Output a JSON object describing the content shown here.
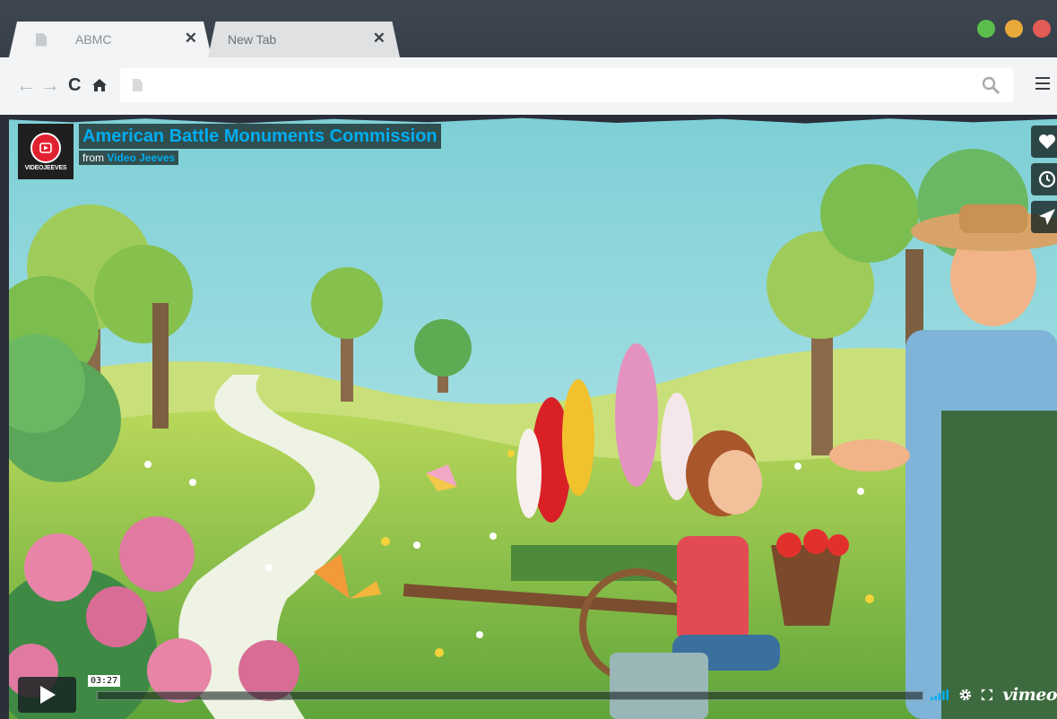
{
  "browser": {
    "tabs": [
      {
        "label": "ABMC",
        "close": "✕",
        "active": true
      },
      {
        "label": "New Tab",
        "close": "✕",
        "active": false
      }
    ],
    "nav": {
      "back": "←",
      "forward": "→",
      "reload": "C",
      "home": "⌂"
    },
    "url_value": ""
  },
  "player": {
    "title": "American Battle Monuments Commission",
    "from_label": "from",
    "owner": "Video Jeeves",
    "channel_logo_text": "VIDEOJEEVES",
    "timecode": "03:27",
    "progress": 0,
    "brand": "vimeo"
  },
  "colors": {
    "accent": "#00adef",
    "overlay": "#172322",
    "sky": "#8cd3d8",
    "grass": "#8cc63f"
  }
}
